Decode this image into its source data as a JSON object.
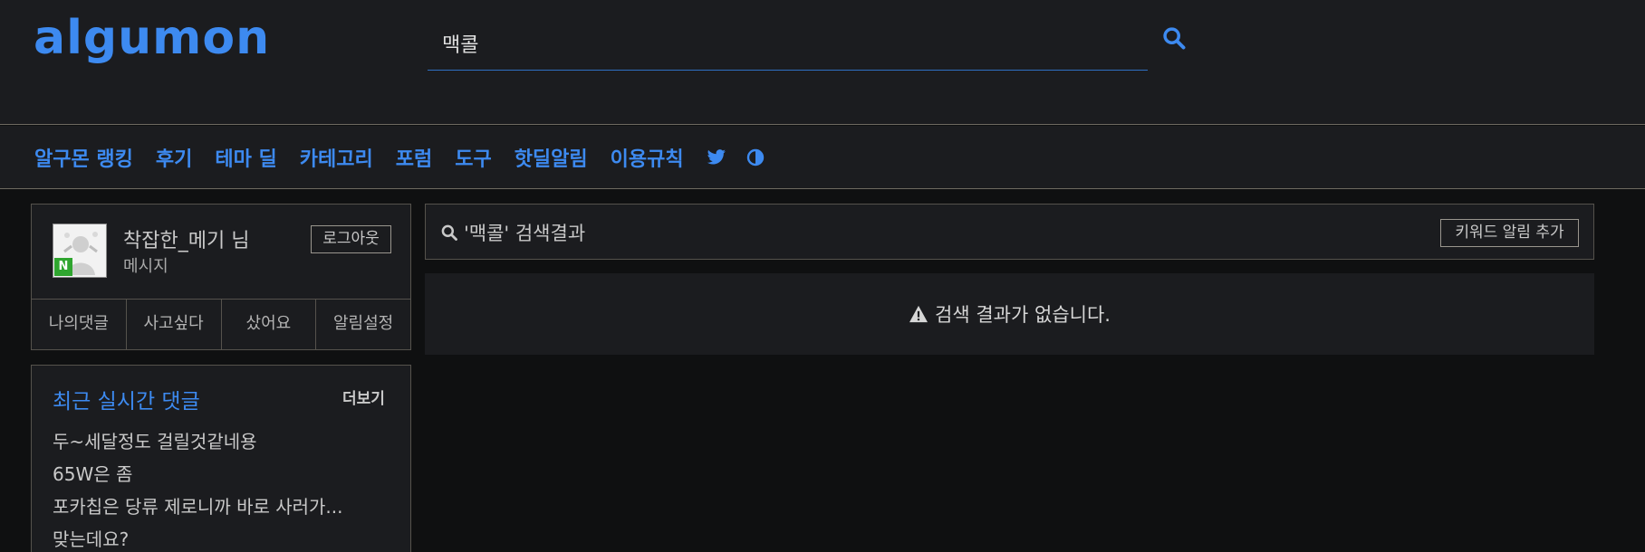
{
  "header": {
    "logo_text": "algumon",
    "search": {
      "value": "맥콜",
      "placeholder": ""
    }
  },
  "nav": {
    "items": [
      {
        "label": "알구몬 랭킹"
      },
      {
        "label": "후기"
      },
      {
        "label": "테마 딜"
      },
      {
        "label": "카테고리"
      },
      {
        "label": "포럼"
      },
      {
        "label": "도구"
      },
      {
        "label": "핫딜알림"
      },
      {
        "label": "이용규칙"
      }
    ],
    "icons": [
      "twitter-icon",
      "theme-toggle-icon"
    ]
  },
  "profile": {
    "name": "착잡한_메기 님",
    "message_link": "메시지",
    "badge": "N",
    "logout_label": "로그아웃",
    "tabs": [
      {
        "label": "나의댓글"
      },
      {
        "label": "사고싶다"
      },
      {
        "label": "샀어요"
      },
      {
        "label": "알림설정"
      }
    ]
  },
  "recent_comments": {
    "title": "최근 실시간 댓글",
    "more_label": "더보기",
    "items": [
      "두~세달정도 걸릴것같네용",
      "65W은 좀",
      "포카칩은 당류 제로니까 바로 사러가...",
      "맞는데요?"
    ]
  },
  "results": {
    "title": "'맥콜' 검색결과",
    "keyword_alert_label": "키워드 알림 추가",
    "empty_message": "검색 결과가 없습니다."
  },
  "colors": {
    "accent": "#3d8af0",
    "panel": "#1b1c1f",
    "background": "#0f1011",
    "border": "#55524c",
    "badge_green": "#2fa52f"
  }
}
